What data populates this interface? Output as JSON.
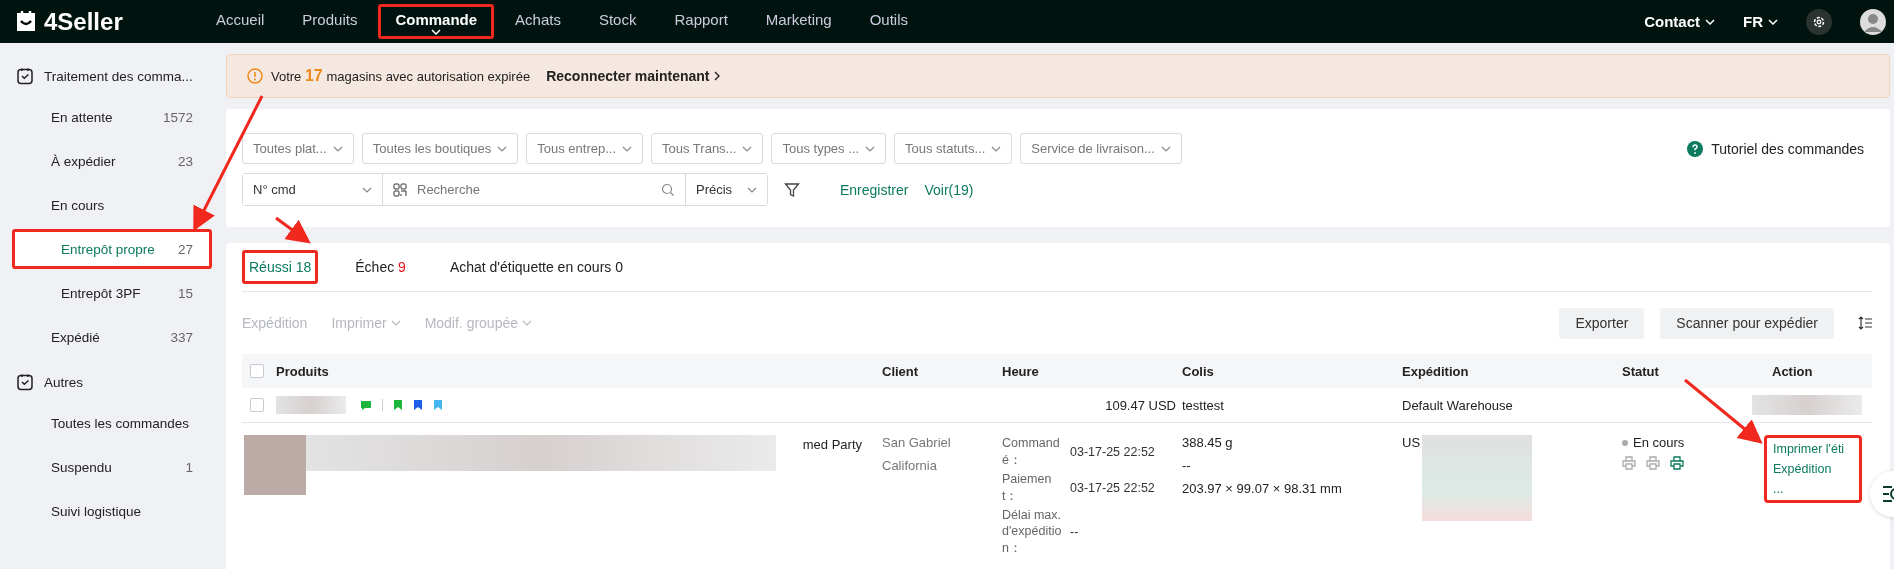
{
  "topbar": {
    "logo": "4Seller",
    "nav": [
      {
        "label": "Accueil",
        "selected": false,
        "highlighted": false
      },
      {
        "label": "Produits",
        "selected": false,
        "highlighted": false
      },
      {
        "label": "Commande",
        "selected": true,
        "highlighted": true
      },
      {
        "label": "Achats",
        "selected": false,
        "highlighted": false
      },
      {
        "label": "Stock",
        "selected": false,
        "highlighted": false
      },
      {
        "label": "Rapport",
        "selected": false,
        "highlighted": false
      },
      {
        "label": "Marketing",
        "selected": false,
        "highlighted": false
      },
      {
        "label": "Outils",
        "selected": false,
        "highlighted": false
      }
    ],
    "right": [
      "Contact",
      "FR"
    ]
  },
  "sidebar": {
    "sections": [
      {
        "title": "Traitement des comma...",
        "items": [
          {
            "label": "En attente",
            "count": "1572",
            "selected": false,
            "highlighted": false
          },
          {
            "label": "À expédier",
            "count": "23",
            "selected": false,
            "highlighted": false
          },
          {
            "label": "En cours",
            "selected": false,
            "highlighted": false,
            "children": [
              {
                "label": "Entrepôt propre",
                "count": "27",
                "selected": true,
                "highlighted": true
              },
              {
                "label": "Entrepôt 3PF",
                "count": "15",
                "selected": false,
                "highlighted": false
              }
            ]
          },
          {
            "label": "Expédié",
            "count": "337",
            "selected": false,
            "highlighted": false
          }
        ]
      },
      {
        "title": "Autres",
        "items": [
          {
            "label": "Toutes les commandes",
            "selected": false,
            "highlighted": false
          },
          {
            "label": "Suspendu",
            "count": "1",
            "selected": false,
            "highlighted": false
          },
          {
            "label": "Suivi logistique",
            "selected": false,
            "highlighted": false
          }
        ]
      }
    ]
  },
  "banner": {
    "before": "Votre",
    "number": "17",
    "after": "magasins avec autorisation expirée",
    "link": "Reconnecter maintenant"
  },
  "filters": {
    "dropdowns": [
      "Toutes plat...",
      "Toutes les boutiques",
      "Tous entrep...",
      "Tous Trans...",
      "Tous types ...",
      "Tous statuts...",
      "Service de livraison..."
    ],
    "tutorial": "Tutoriel des commandes",
    "search_type": "N° cmd",
    "search": {
      "placeholder": "Recherche"
    },
    "match": "Précis",
    "links": [
      "Enregistrer",
      "Voir(19)"
    ]
  },
  "tabs": [
    {
      "label": "Réussi",
      "count": "18",
      "selected": true,
      "highlighted": true,
      "alert": false
    },
    {
      "label": "Échec",
      "count": "9",
      "selected": false,
      "highlighted": false,
      "alert": true
    },
    {
      "label": "Achat d'étiquette en cours",
      "count": "0",
      "selected": false,
      "highlighted": false,
      "alert": false
    }
  ],
  "toolbar": {
    "actions": [
      {
        "label": "Expédition",
        "dropdown": false
      },
      {
        "label": "Imprimer",
        "dropdown": true
      },
      {
        "label": "Modif. groupée",
        "dropdown": true
      }
    ],
    "buttons": [
      "Exporter",
      "Scanner pour expédier"
    ]
  },
  "table": {
    "columns": [
      "Produits",
      "Client",
      "Heure",
      "Colis",
      "Expédition",
      "Statut",
      "Action"
    ],
    "header_checked": false,
    "order": {
      "checked": false,
      "amount": "109.47 USD",
      "package": "testtest",
      "warehouse": "Default Warehouse",
      "tags": [
        {
          "kind": "chat",
          "color": "#1db43c"
        },
        {
          "kind": "flag",
          "color": "#1db43c"
        },
        {
          "kind": "flag",
          "color": "#1f5ee8"
        },
        {
          "kind": "flag",
          "color": "#45b7f0"
        }
      ]
    },
    "row": {
      "product": "med Party",
      "client": [
        "San Gabriel",
        "California"
      ],
      "times": [
        {
          "label": "Commandé：",
          "value": "03-17-25 22:52"
        },
        {
          "label": "Paiement：",
          "value": "03-17-25 22:52"
        },
        {
          "label": "Délai max. d'expédition：",
          "value": "--"
        }
      ],
      "package": [
        "388.45 g",
        "--",
        "203.97 × 99.07 × 98.31 mm"
      ],
      "shipping": "US",
      "status": "En cours",
      "printers": [
        {
          "done": false
        },
        {
          "done": false
        },
        {
          "done": true
        }
      ],
      "actions": [
        "Imprimer l'éti",
        "Expédition",
        "..."
      ],
      "actions_highlighted": true
    }
  }
}
